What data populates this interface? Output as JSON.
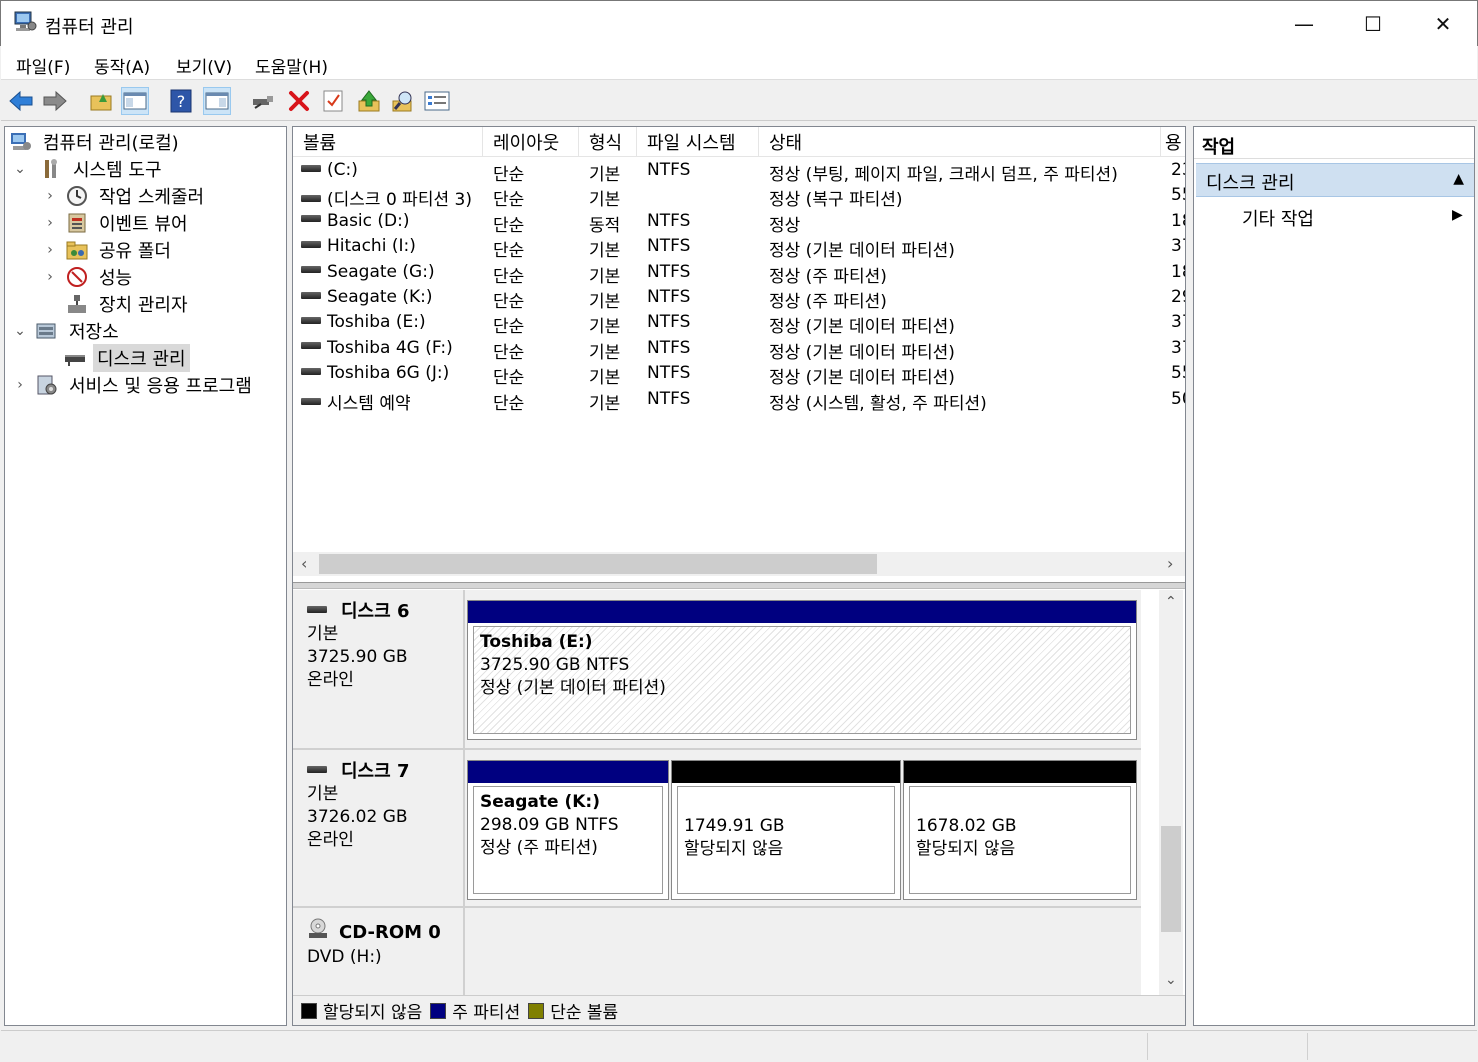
{
  "window": {
    "title": "컴퓨터 관리",
    "minimize": "—",
    "maximize": "☐",
    "close": "✕"
  },
  "menu": [
    {
      "label": "파일(F)"
    },
    {
      "label": "동작(A)"
    },
    {
      "label": "보기(V)"
    },
    {
      "label": "도움말(H)"
    }
  ],
  "toolbar": [
    "back-icon",
    "forward-icon",
    "up-folder-icon",
    "show-hide-tree-icon",
    "help-icon",
    "show-hide-action-pane-icon",
    "connect-icon",
    "delete-icon",
    "checklist-icon",
    "arrow-up-icon",
    "search-icon",
    "properties-icon"
  ],
  "tree": {
    "root": "컴퓨터 관리(로컬)",
    "system_tools": "시스템 도구",
    "task_scheduler": "작업 스케줄러",
    "event_viewer": "이벤트 뷰어",
    "shared_folders": "공유 폴더",
    "performance": "성능",
    "device_manager": "장치 관리자",
    "storage": "저장소",
    "disk_management": "디스크 관리",
    "services_apps": "서비스 및 응용 프로그램"
  },
  "volumes": {
    "columns": [
      "볼륨",
      "레이아웃",
      "형식",
      "파일 시스템",
      "상태",
      "용"
    ],
    "rows": [
      {
        "name": "(C:)",
        "layout": "단순",
        "type": "기본",
        "fs": "NTFS",
        "status": "정상 (부팅, 페이지 파일, 크래시 덤프, 주 파티션)",
        "cap": "23"
      },
      {
        "name": "(디스크 0 파티션 3)",
        "layout": "단순",
        "type": "기본",
        "fs": "",
        "status": "정상 (복구 파티션)",
        "cap": "55"
      },
      {
        "name": "Basic (D:)",
        "layout": "단순",
        "type": "동적",
        "fs": "NTFS",
        "status": "정상",
        "cap": "18"
      },
      {
        "name": "Hitachi (I:)",
        "layout": "단순",
        "type": "기본",
        "fs": "NTFS",
        "status": "정상 (기본 데이터 파티션)",
        "cap": "37"
      },
      {
        "name": "Seagate (G:)",
        "layout": "단순",
        "type": "기본",
        "fs": "NTFS",
        "status": "정상 (주 파티션)",
        "cap": "18"
      },
      {
        "name": "Seagate (K:)",
        "layout": "단순",
        "type": "기본",
        "fs": "NTFS",
        "status": "정상 (주 파티션)",
        "cap": "29"
      },
      {
        "name": "Toshiba (E:)",
        "layout": "단순",
        "type": "기본",
        "fs": "NTFS",
        "status": "정상 (기본 데이터 파티션)",
        "cap": "37"
      },
      {
        "name": "Toshiba 4G (F:)",
        "layout": "단순",
        "type": "기본",
        "fs": "NTFS",
        "status": "정상 (기본 데이터 파티션)",
        "cap": "37"
      },
      {
        "name": "Toshiba 6G (J:)",
        "layout": "단순",
        "type": "기본",
        "fs": "NTFS",
        "status": "정상 (기본 데이터 파티션)",
        "cap": "55"
      },
      {
        "name": "시스템 예약",
        "layout": "단순",
        "type": "기본",
        "fs": "NTFS",
        "status": "정상 (시스템, 활성, 주 파티션)",
        "cap": "50"
      }
    ]
  },
  "disks": {
    "disk6": {
      "name": "디스크 6",
      "type": "기본",
      "size": "3725.90 GB",
      "state": "온라인",
      "part1": {
        "name": "Toshiba  (E:)",
        "size": "3725.90 GB NTFS",
        "status": "정상 (기본 데이터 파티션)"
      }
    },
    "disk7": {
      "name": "디스크 7",
      "type": "기본",
      "size": "3726.02 GB",
      "state": "온라인",
      "part1": {
        "name": "Seagate  (K:)",
        "size": "298.09 GB NTFS",
        "status": "정상 (주 파티션)"
      },
      "part2": {
        "size": "1749.91 GB",
        "status": "할당되지 않음"
      },
      "part3": {
        "size": "1678.02 GB",
        "status": "할당되지 않음"
      }
    },
    "cdrom": {
      "name": "CD-ROM 0",
      "drive": "DVD (H:)"
    }
  },
  "legend": [
    {
      "label": "할당되지 않음",
      "color": "#000000"
    },
    {
      "label": "주 파티션",
      "color": "#000080"
    },
    {
      "label": "단순 볼륨",
      "color": "#808000"
    }
  ],
  "colors": {
    "primary_partition": "#000080",
    "unallocated": "#000000",
    "action_header": "#cfe0f1"
  },
  "actions": {
    "title": "작업",
    "section": "디스크 관리",
    "more": "기타 작업"
  }
}
